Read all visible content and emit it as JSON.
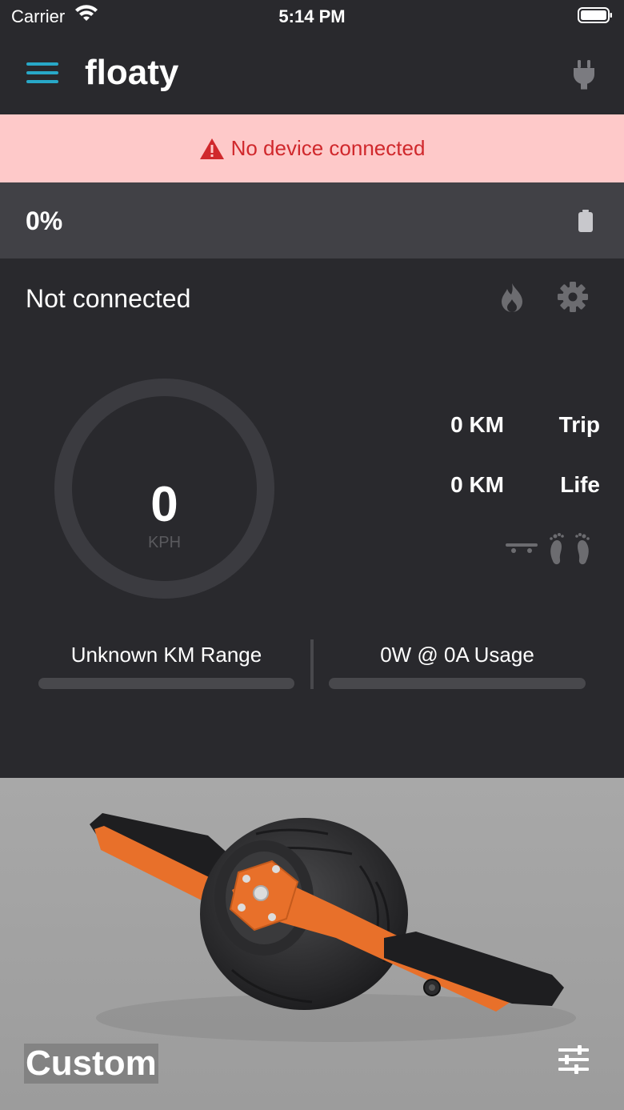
{
  "status_bar": {
    "carrier": "Carrier",
    "time": "5:14 PM"
  },
  "header": {
    "title": "floaty",
    "menu_icon": "hamburger-menu-icon",
    "connect_icon": "plug-icon"
  },
  "alert": {
    "text": "No device connected",
    "color": "#d0282c",
    "background": "#fec9c9"
  },
  "battery": {
    "percent": "0%",
    "level": 0
  },
  "device": {
    "status": "Not connected"
  },
  "speed": {
    "value": "0",
    "unit": "KPH"
  },
  "stats": {
    "trip_value": "0 KM",
    "trip_label": "Trip",
    "life_value": "0 KM",
    "life_label": "Life"
  },
  "range": {
    "label": "Unknown KM Range",
    "level": 0
  },
  "usage": {
    "label": "0W @ 0A Usage",
    "level": 0
  },
  "board": {
    "mode": "Custom"
  },
  "colors": {
    "accent": "#28a8c8",
    "background": "#29292d",
    "board_orange": "#e8702a"
  }
}
